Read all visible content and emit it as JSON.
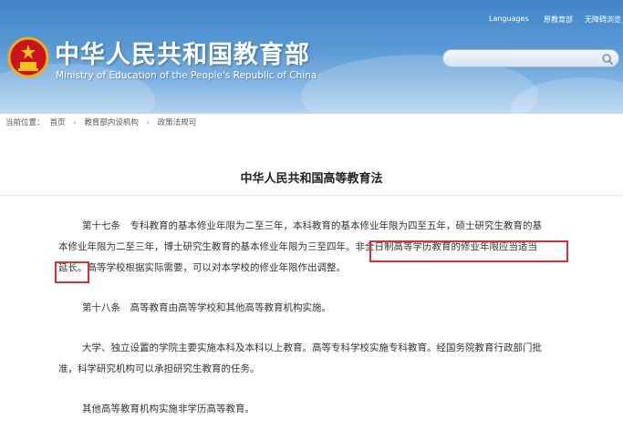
{
  "header": {
    "title_cn": "中华人民共和国教育部",
    "title_en": "Ministry of Education of the People's Republic of China",
    "links": [
      "Languages",
      "原教育部",
      "无障碍浏览"
    ],
    "search_placeholder": ""
  },
  "breadcrumb": {
    "prefix": "当前位置：",
    "items": [
      "首页",
      "教育部内设机构",
      "政策法规司"
    ]
  },
  "article": {
    "title": "中华人民共和国高等教育法",
    "p1_line1": "第十七条　专科教育的基本修业年限为二至三年，本科教育的基本修业年限为四至五年，硕士研究生教育的基",
    "p1_line2_a": "本修业年限为二至三年，博士研究生教育的基本修业年限为三至四年。",
    "p1_line2_b": "非全日制高等学历教育的修业年限应当适当",
    "p1_line3_a": "延长。",
    "p1_line3_b": "高等学校根据实际需要，可以对本学校的修业年限作出调整。",
    "p2": "第十八条　高等教育由高等学校和其他高等教育机构实施。",
    "p3_line1": "大学、独立设置的学院主要实施本科及本科以上教育。高等专科学校实施专科教育。经国务院教育行政部门批",
    "p3_line2": "准，科学研究机构可以承担研究生教育的任务。",
    "p4": "其他高等教育机构实施非学历高等教育。"
  },
  "colors": {
    "header_blue": "#3f86c6",
    "highlight_red": "#d4323b"
  }
}
